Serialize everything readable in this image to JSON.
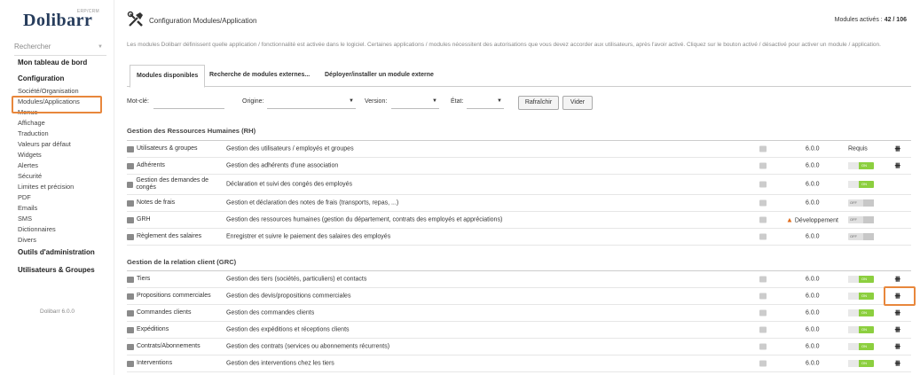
{
  "logo": {
    "text": "Dolibarr",
    "sub": "ERP/CRM"
  },
  "sidebar": {
    "search_placeholder": "Rechercher",
    "version": "Dolibarr 6.0.0",
    "items": [
      {
        "label": "Mon tableau de bord",
        "level": "top"
      },
      {
        "label": "Configuration",
        "level": "top"
      },
      {
        "label": "Société/Organisation",
        "level": "sub"
      },
      {
        "label": "Modules/Applications",
        "level": "sub"
      },
      {
        "label": "Menus",
        "level": "sub"
      },
      {
        "label": "Affichage",
        "level": "sub"
      },
      {
        "label": "Traduction",
        "level": "sub"
      },
      {
        "label": "Valeurs par défaut",
        "level": "sub"
      },
      {
        "label": "Widgets",
        "level": "sub"
      },
      {
        "label": "Alertes",
        "level": "sub"
      },
      {
        "label": "Sécurité",
        "level": "sub"
      },
      {
        "label": "Limites et précision",
        "level": "sub"
      },
      {
        "label": "PDF",
        "level": "sub"
      },
      {
        "label": "Emails",
        "level": "sub"
      },
      {
        "label": "SMS",
        "level": "sub"
      },
      {
        "label": "Dictionnaires",
        "level": "sub"
      },
      {
        "label": "Divers",
        "level": "sub"
      },
      {
        "label": "Outils d'administration",
        "level": "top"
      },
      {
        "label": "Utilisateurs & Groupes",
        "level": "top"
      }
    ]
  },
  "header": {
    "title": "Configuration Modules/Application",
    "count_label": "Modules activés :",
    "count_value": "42 / 106"
  },
  "description": "Les modules Dolibarr définissent quelle application / fonctionnalité est activée dans le logiciel. Certaines applications / modules nécessitent des autorisations que vous devez accorder aux utilisateurs, après l'avoir activé. Cliquez sur le bouton activé / désactivé pour activer un module / application.",
  "tabs": [
    {
      "label": "Modules disponibles",
      "active": true
    },
    {
      "label": "Recherche de modules externes...",
      "active": false
    },
    {
      "label": "Déployer/installer un module externe",
      "active": false
    }
  ],
  "filter": {
    "keyword_label": "Mot-clé:",
    "origin_label": "Origine:",
    "version_label": "Version:",
    "state_label": "État:",
    "refresh_button": "Rafraîchir",
    "clear_button": "Vider"
  },
  "sections": [
    {
      "title": "Gestion des Ressources Humaines (RH)",
      "rows": [
        {
          "name": "Utilisateurs & groupes",
          "desc": "Gestion des utilisateurs / employés et groupes",
          "version": "6.0.0",
          "status": "Requis",
          "settings": true
        },
        {
          "name": "Adhérents",
          "desc": "Gestion des adhérents d'une association",
          "version": "6.0.0",
          "status": "on",
          "settings": true
        },
        {
          "name": "Gestion des demandes de congés",
          "desc": "Déclaration et suivi des congés des employés",
          "version": "6.0.0",
          "status": "on",
          "settings": false
        },
        {
          "name": "Notes de frais",
          "desc": "Gestion et déclaration des notes de frais (transports, repas, ...)",
          "version": "6.0.0",
          "status": "off",
          "settings": false
        },
        {
          "name": "GRH",
          "desc": "Gestion des ressources humaines (gestion du département, contrats des employés et appréciations)",
          "version": "Développement",
          "status": "off",
          "settings": false,
          "warning": true
        },
        {
          "name": "Règlement des salaires",
          "desc": "Enregistrer et suivre le paiement des salaires des employés",
          "version": "6.0.0",
          "status": "off",
          "settings": false
        }
      ]
    },
    {
      "title": "Gestion de la relation client (GRC)",
      "rows": [
        {
          "name": "Tiers",
          "desc": "Gestion des tiers (sociétés, particuliers) et contacts",
          "version": "6.0.0",
          "status": "on",
          "settings": true
        },
        {
          "name": "Propositions commerciales",
          "desc": "Gestion des devis/propositions commerciales",
          "version": "6.0.0",
          "status": "on",
          "settings": true
        },
        {
          "name": "Commandes clients",
          "desc": "Gestion des commandes clients",
          "version": "6.0.0",
          "status": "on",
          "settings": true
        },
        {
          "name": "Expéditions",
          "desc": "Gestion des expéditions et réceptions clients",
          "version": "6.0.0",
          "status": "on",
          "settings": true
        },
        {
          "name": "Contrats/Abonnements",
          "desc": "Gestion des contrats (services ou abonnements récurrents)",
          "version": "6.0.0",
          "status": "on",
          "settings": true
        },
        {
          "name": "Interventions",
          "desc": "Gestion des interventions chez les tiers",
          "version": "6.0.0",
          "status": "on",
          "settings": true
        }
      ]
    }
  ],
  "toggle_text": {
    "on": "ON",
    "off": "OFF"
  },
  "settings_glyph": "⧻",
  "warning_glyph": "▲"
}
